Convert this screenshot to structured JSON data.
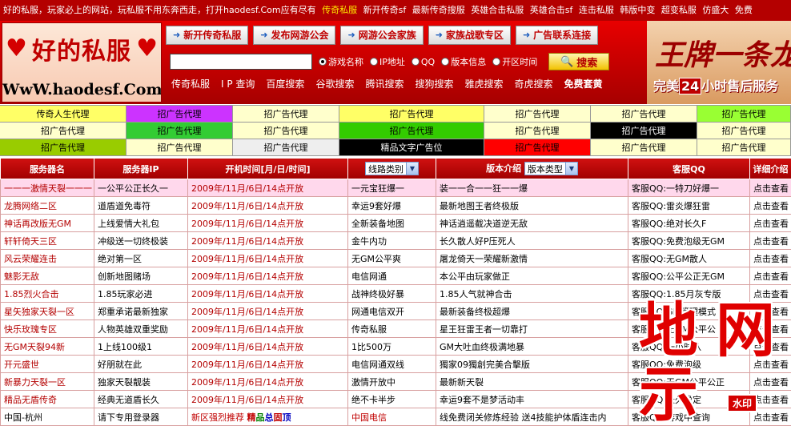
{
  "marquee": {
    "intro": "好的私服，玩家必上的网站，玩私服不用东奔西走，打开haodesf.Com应有尽有",
    "items": [
      "传奇私服",
      "新开传奇sf",
      "最新传奇搜服",
      "英雄合击私服",
      "英雄合击sf",
      "连击私服",
      "韩版中变",
      "超变私服",
      "仿盛大",
      "免费"
    ]
  },
  "logo": {
    "title": "好的私服",
    "url": "WwW.haodesf.Com",
    "heart": "♥"
  },
  "nav": [
    "新开传奇私服",
    "发布网游公会",
    "网游公会家族",
    "家族战歌专区",
    "广告联系连接"
  ],
  "search": {
    "value": "",
    "options": [
      {
        "label": "游戏名称",
        "selected": true
      },
      {
        "label": "IP地址",
        "selected": false
      },
      {
        "label": "QQ",
        "selected": false
      },
      {
        "label": "版本信息",
        "selected": false
      },
      {
        "label": "开区时间",
        "selected": false
      }
    ],
    "button": "搜索"
  },
  "links": [
    "传奇私服",
    "I P 查询",
    "百度搜索",
    "谷歌搜索",
    "腾讯搜索",
    "搜狗搜索",
    "雅虎搜索",
    "奇虎搜索",
    "免费套黄"
  ],
  "banner": {
    "headline": "王牌一条龙",
    "sub_pre": "完美",
    "sub_num": "24",
    "sub_post": "小时售后服务"
  },
  "ad_grid": {
    "rows": [
      [
        {
          "text": "传奇人生代理",
          "bg": "#ffff66",
          "color": "#000000"
        },
        {
          "text": "招广告代理",
          "bg": "#cc33ff",
          "color": "#000000"
        },
        {
          "text": "招广告代理",
          "bg": "#ffffcc",
          "color": "#000000"
        },
        {
          "text": "招广告代理",
          "bg": "#ffff66",
          "color": "#000000"
        },
        {
          "text": "招广告代理",
          "bg": "#ffffcc",
          "color": "#000000"
        },
        {
          "text": "招广告代理",
          "bg": "#ffffcc",
          "color": "#000000"
        },
        {
          "text": "招广告代理",
          "bg": "#99ff33",
          "color": "#000000"
        }
      ],
      [
        {
          "text": "招广告代理",
          "bg": "#ffffcc",
          "color": "#000000"
        },
        {
          "text": "招广告代理",
          "bg": "#33cc33",
          "color": "#000000"
        },
        {
          "text": "招广告代理",
          "bg": "#ffffcc",
          "color": "#000000"
        },
        {
          "text": "招广告代理",
          "bg": "#33cc00",
          "color": "#000000"
        },
        {
          "text": "招广告代理",
          "bg": "#ffffcc",
          "color": "#000000"
        },
        {
          "text": "招广告代理",
          "bg": "#000000",
          "color": "#ffffff"
        },
        {
          "text": "招广告代理",
          "bg": "#ffffcc",
          "color": "#000000"
        }
      ],
      [
        {
          "text": "招广告代理",
          "bg": "#99cc00",
          "color": "#000000"
        },
        {
          "text": "招广告代理",
          "bg": "#ffffcc",
          "color": "#000000"
        },
        {
          "text": "招广告代理",
          "bg": "#eeeeee",
          "color": "#000000"
        },
        {
          "text": "精品文字广告位",
          "bg": "#000000",
          "color": "#ffffff"
        },
        {
          "text": "招广告代理",
          "bg": "#ff0000",
          "color": "#000000"
        },
        {
          "text": "招广告代理",
          "bg": "#ffffcc",
          "color": "#000000"
        },
        {
          "text": "招广告代理",
          "bg": "#ffffcc",
          "color": "#000000"
        }
      ]
    ]
  },
  "table": {
    "headers": {
      "name": "服务器名",
      "ip": "服务器IP",
      "time": "开机时间[月/日/时间]",
      "line_select": "线路类别",
      "version": "版本介绍",
      "version_select": "版本类型",
      "qq": "客服QQ",
      "more": "详细介绍"
    },
    "rows": [
      {
        "name": "一一一激情天裂一一一",
        "ip": "一公平公正长久一",
        "time": "2009年/11月/6日/14点开放",
        "line": "一元宝狂爆一",
        "version": "装一一合一一狂一一爆",
        "qq": "客服QQ:一特刀好爆一",
        "more": "点击查看"
      },
      {
        "name": "龙腾网络二区",
        "ip": "道盾道免毒符",
        "time": "2009年/11月/6日/14点开放",
        "line": "幸运9套好爆",
        "version": "最新地图王者终极版",
        "qq": "客服QQ:雷炎爆狂雷",
        "more": "点击查看"
      },
      {
        "name": "神话再改版无GM",
        "ip": "上线爱情大礼包",
        "time": "2009年/11月/6日/14点开放",
        "line": "全新装备地图",
        "version": "神话逍遥截决道逆无敌",
        "qq": "客服QQ:绝对长久F",
        "more": "点击查看"
      },
      {
        "name": "轩轩倚天三区",
        "ip": "冲级送一切终极装",
        "time": "2009年/11月/6日/14点开放",
        "line": "金牛内功",
        "version": "长久散人好P压死人",
        "qq": "客服QQ:免费泡级无GM",
        "more": "点击查看"
      },
      {
        "name": "风云荣耀连击",
        "ip": "绝对第一区",
        "time": "2009年/11月/6日/14点开放",
        "line": "无GM公平爽",
        "version": "屠龙倚天一荣耀新激情",
        "qq": "客服QQ:无GM散人",
        "more": "点击查看"
      },
      {
        "name": "魅影无敌",
        "ip": "创新地图赌场",
        "time": "2009年/11月/6日/14点开放",
        "line": "电信网通",
        "version": "本公平由玩家做正",
        "qq": "客服QQ:公平公正无GM",
        "more": "点击查看"
      },
      {
        "name": "1.85烈火合击",
        "ip": "1.85玩家必进",
        "time": "2009年/11月/6日/14点开放",
        "line": "战神终极好暴",
        "version": "1.85人气就神合击",
        "qq": "客服QQ:1.85月灰专版",
        "more": "点击查看"
      },
      {
        "name": "星矢独家天裂一区",
        "ip": "郑重承诺最新独家",
        "time": "2009年/11月/6日/14点开放",
        "line": "网通电信双开",
        "version": "最新装备终极超爆",
        "qq": "客服QQ:GM管理模式",
        "more": "点击查看"
      },
      {
        "name": "快乐玫瑰专区",
        "ip": "人物英雄双重奖励",
        "time": "2009年/11月/6日/14点开放",
        "line": "传奇私服",
        "version": "星王狂雷王者一切靠打",
        "qq": "客服QQ:无GM公平公",
        "more": "点击查看"
      },
      {
        "name": "无GM天裂94新",
        "ip": "1上线100级1",
        "time": "2009年/11月/6日/14点开放",
        "line": "1比500万",
        "version": "GM大吐血终极满地暴",
        "qq": "客服QQ:一小时八",
        "more": "点击查看"
      },
      {
        "name": "开元盛世",
        "ip": "好朋就在此",
        "time": "2009年/11月/6日/14点开放",
        "line": "电信网通双线",
        "version": "獨家09獨創完美合擊版",
        "qq": "客服QQ:免费泡级",
        "more": "点击查看"
      },
      {
        "name": "新暴力天裂一区",
        "ip": "独家天裂靓装",
        "time": "2009年/11月/6日/14点开放",
        "line": "激情开放中",
        "version": "最新新天裂",
        "qq": "客服QQ:无GM公平公正",
        "more": "点击查看"
      },
      {
        "name": "精品无盾传奇",
        "ip": "经典无道盾长久",
        "time": "2009年/11月/6日/14点开放",
        "line": "绝不卡半步",
        "version": "幸运9套不是梦活动丰",
        "qq": "客服QQ:长久稳定",
        "more": "点击查看"
      }
    ],
    "last_row": {
      "name": "中国-杭州",
      "ip": "请下专用登录器",
      "time_pre": "新区强烈推荐",
      "time_a": "精",
      "time_b": "品",
      "time_c": "总",
      "time_d": "固",
      "time_e": "顶",
      "line": "中国电信",
      "version": "线免费闭关修炼经验  送4技能护体盾连击内",
      "qq": "客服QQ:游戏中查询",
      "more": "点击查看"
    }
  },
  "watermark": {
    "chars": [
      "地",
      "网",
      "示",
      "网"
    ],
    "badge": "水印"
  }
}
